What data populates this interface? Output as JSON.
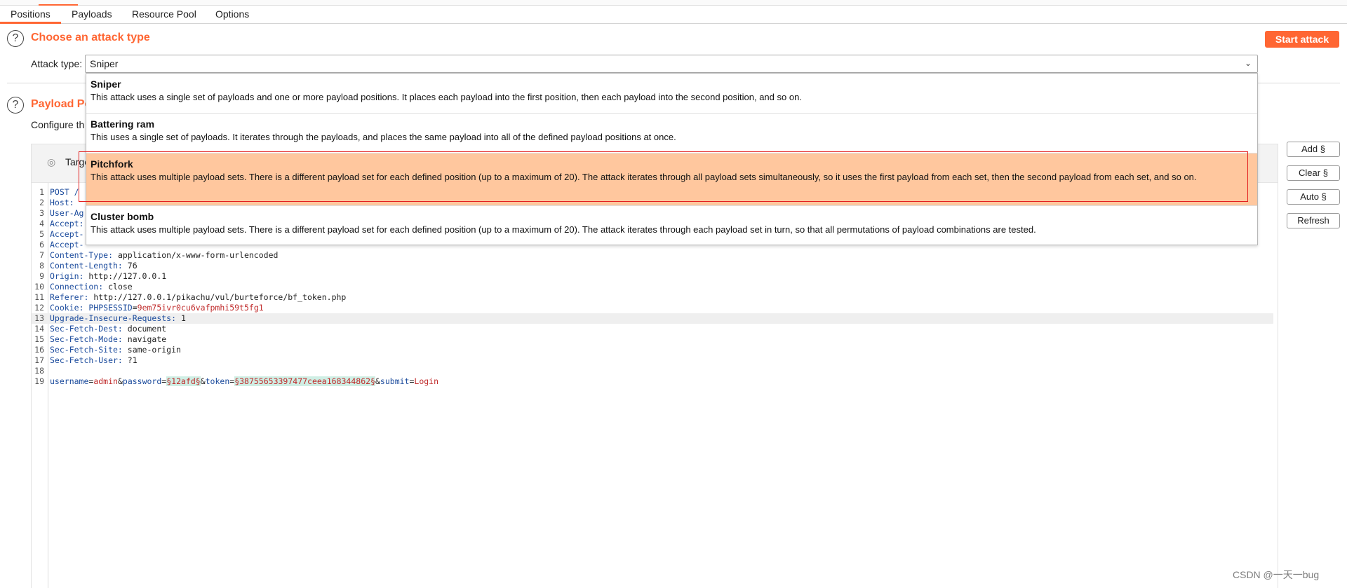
{
  "tabs": [
    "Positions",
    "Payloads",
    "Resource Pool",
    "Options"
  ],
  "attack_type_section": {
    "title": "Choose an attack type",
    "label": "Attack type:",
    "selected": "Sniper",
    "start_button": "Start attack"
  },
  "positions_section": {
    "title": "Payload Po",
    "description": "Configure th",
    "target_label": "Targe"
  },
  "dropdown": {
    "options": [
      {
        "name": "Sniper",
        "description": "This attack uses a single set of payloads and one or more payload positions. It places each payload into the first position, then each payload into the second position, and so on."
      },
      {
        "name": "Battering ram",
        "description": "This uses a single set of payloads. It iterates through the payloads, and places the same payload into all of the defined payload positions at once."
      },
      {
        "name": "Pitchfork",
        "description": "This attack uses multiple payload sets. There is a different payload set for each defined position (up to a maximum of 20). The attack iterates through all payload sets simultaneously, so it uses the first payload from each set, then the second payload from each set, and so on."
      },
      {
        "name": "Cluster bomb",
        "description": "This attack uses multiple payload sets. There is a different payload set for each defined position (up to a maximum of 20). The attack iterates through each payload set in turn, so that all permutations of payload combinations are tested."
      }
    ],
    "highlighted": "Pitchfork"
  },
  "request": {
    "lines": [
      {
        "n": "1",
        "key": "POST /",
        "val": ""
      },
      {
        "n": "2",
        "key": "Host:",
        "val": ""
      },
      {
        "n": "3",
        "key": "User-Ag",
        "val": ""
      },
      {
        "n": "4",
        "key": "Accept:",
        "val": ""
      },
      {
        "n": "5",
        "key": "Accept-",
        "val": ""
      },
      {
        "n": "6",
        "key": "Accept-",
        "val": ""
      },
      {
        "n": "7",
        "key": "Content-Type:",
        "val": " application/x-www-form-urlencoded"
      },
      {
        "n": "8",
        "key": "Content-Length:",
        "val": " 76"
      },
      {
        "n": "9",
        "key": "Origin:",
        "val": " http://127.0.0.1"
      },
      {
        "n": "10",
        "key": "Connection:",
        "val": " close"
      },
      {
        "n": "11",
        "key": "Referer:",
        "val": " http://127.0.0.1/pikachu/vul/burteforce/bf_token.php"
      },
      {
        "n": "12",
        "key": "Cookie:",
        "val": ""
      },
      {
        "n": "13",
        "key": "Upgrade-Insecure-Requests:",
        "val": " 1"
      },
      {
        "n": "14",
        "key": "Sec-Fetch-Dest:",
        "val": " document"
      },
      {
        "n": "15",
        "key": "Sec-Fetch-Mode:",
        "val": " navigate"
      },
      {
        "n": "16",
        "key": "Sec-Fetch-Site:",
        "val": " same-origin"
      },
      {
        "n": "17",
        "key": "Sec-Fetch-User:",
        "val": " ?1"
      },
      {
        "n": "18",
        "key": "",
        "val": ""
      },
      {
        "n": "19",
        "key": "",
        "val": ""
      }
    ],
    "cookie": {
      "name": " PHPSESSID",
      "eq": "=",
      "value": "9em75ivr0cu6vafpmhi59t5fg1"
    },
    "body": {
      "k1": "username",
      "eq1": "=",
      "v1": "admin",
      "amp1": "&",
      "k2": "password",
      "eq2": "=",
      "p1": "§12afd§",
      "amp2": "&",
      "k3": "token",
      "eq3": "=",
      "p2": "§38755653397477ceea168344862§",
      "amp3": "&",
      "k4": "submit",
      "eq4": "=",
      "v4": "Login"
    }
  },
  "side_buttons": [
    "Add §",
    "Clear §",
    "Auto §",
    "Refresh"
  ],
  "watermark": "CSDN @一天一bug",
  "colors": {
    "accent": "#ff6633",
    "selected_option": "#ffc79e",
    "annotation_box": "#e32020"
  }
}
